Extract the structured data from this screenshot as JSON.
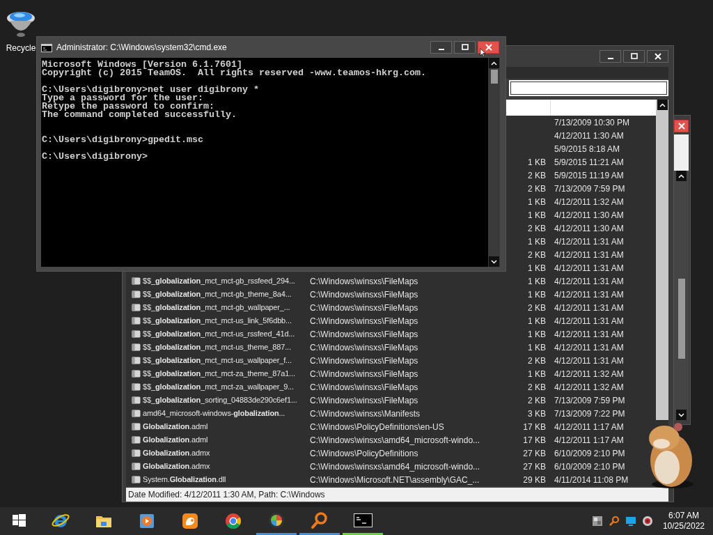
{
  "desktop": {
    "icons": [
      {
        "label": "Recycle"
      }
    ]
  },
  "cmd_window": {
    "title": "Administrator: C:\\Windows\\system32\\cmd.exe",
    "console": "Microsoft Windows [Version 6.1.7601]\nCopyright (c) 2015 TeamOS.  All rights reserved -www.teamos-hkrg.com.\n\nC:\\Users\\digibrony>net user digibrony *\nType a password for the user:\nRetype the password to confirm:\nThe command completed successfully.\n\n\nC:\\Users\\digibrony>gpedit.msc\n\nC:\\Users\\digibrony>"
  },
  "search_window": {
    "rows": [
      {
        "date": "7/13/2009 10:30 PM"
      },
      {
        "date": "4/12/2011 1:30 AM"
      },
      {
        "date": "5/9/2015 8:18 AM"
      },
      {
        "size": "1 KB",
        "date": "5/9/2015 11:21 AM"
      },
      {
        "size": "2 KB",
        "date": "5/9/2015 11:19 AM"
      },
      {
        "size": "2 KB",
        "date": "7/13/2009 7:59 PM"
      },
      {
        "size": "1 KB",
        "date": "4/12/2011 1:32 AM"
      },
      {
        "size": "1 KB",
        "date": "4/12/2011 1:30 AM"
      },
      {
        "size": "2 KB",
        "date": "4/12/2011 1:30 AM"
      },
      {
        "size": "1 KB",
        "date": "4/12/2011 1:31 AM"
      },
      {
        "size": "2 KB",
        "date": "4/12/2011 1:31 AM"
      },
      {
        "size": "1 KB",
        "date": "4/12/2011 1:31 AM"
      },
      {
        "name": "$$_**globalization**_mct_mct-gb_rssfeed_294...",
        "path": "C:\\Windows\\winsxs\\FileMaps",
        "size": "1 KB",
        "date": "4/12/2011 1:31 AM"
      },
      {
        "name": "$$_**globalization**_mct_mct-gb_theme_8a4...",
        "path": "C:\\Windows\\winsxs\\FileMaps",
        "size": "1 KB",
        "date": "4/12/2011 1:31 AM"
      },
      {
        "name": "$$_**globalization**_mct_mct-gb_wallpaper_...",
        "path": "C:\\Windows\\winsxs\\FileMaps",
        "size": "2 KB",
        "date": "4/12/2011 1:31 AM"
      },
      {
        "name": "$$_**globalization**_mct_mct-us_link_5f6dbb...",
        "path": "C:\\Windows\\winsxs\\FileMaps",
        "size": "1 KB",
        "date": "4/12/2011 1:31 AM"
      },
      {
        "name": "$$_**globalization**_mct_mct-us_rssfeed_41d...",
        "path": "C:\\Windows\\winsxs\\FileMaps",
        "size": "1 KB",
        "date": "4/12/2011 1:31 AM"
      },
      {
        "name": "$$_**globalization**_mct_mct-us_theme_887...",
        "path": "C:\\Windows\\winsxs\\FileMaps",
        "size": "1 KB",
        "date": "4/12/2011 1:31 AM"
      },
      {
        "name": "$$_**globalization**_mct_mct-us_wallpaper_f...",
        "path": "C:\\Windows\\winsxs\\FileMaps",
        "size": "2 KB",
        "date": "4/12/2011 1:31 AM"
      },
      {
        "name": "$$_**globalization**_mct_mct-za_theme_87a1...",
        "path": "C:\\Windows\\winsxs\\FileMaps",
        "size": "1 KB",
        "date": "4/12/2011 1:32 AM"
      },
      {
        "name": "$$_**globalization**_mct_mct-za_wallpaper_9...",
        "path": "C:\\Windows\\winsxs\\FileMaps",
        "size": "2 KB",
        "date": "4/12/2011 1:32 AM"
      },
      {
        "name": "$$_**globalization**_sorting_04883de290c6ef1...",
        "path": "C:\\Windows\\winsxs\\FileMaps",
        "size": "2 KB",
        "date": "7/13/2009 7:59 PM"
      },
      {
        "name": "amd64_microsoft-windows-**globalization**...",
        "path": "C:\\Windows\\winsxs\\Manifests",
        "size": "3 KB",
        "date": "7/13/2009 7:22 PM"
      },
      {
        "name": "**Globalization**.adml",
        "path": "C:\\Windows\\PolicyDefinitions\\en-US",
        "size": "17 KB",
        "date": "4/12/2011 1:17 AM"
      },
      {
        "name": "**Globalization**.adml",
        "path": "C:\\Windows\\winsxs\\amd64_microsoft-windo...",
        "size": "17 KB",
        "date": "4/12/2011 1:17 AM"
      },
      {
        "name": "**Globalization**.admx",
        "path": "C:\\Windows\\PolicyDefinitions",
        "size": "27 KB",
        "date": "6/10/2009 2:10 PM"
      },
      {
        "name": "**Globalization**.admx",
        "path": "C:\\Windows\\winsxs\\amd64_microsoft-windo...",
        "size": "27 KB",
        "date": "6/10/2009 2:10 PM"
      },
      {
        "name": "System.**Globalization**.dll",
        "path": "C:\\Windows\\Microsoft.NET\\assembly\\GAC_...",
        "size": "29 KB",
        "date": "4/11/2014 11:08 PM"
      }
    ],
    "status_bar": "Date Modified: 4/12/2011 1:30 AM, Path: C:\\Windows"
  },
  "taskbar": {
    "apps": [
      {
        "kind": "start",
        "running": false
      },
      {
        "kind": "ie",
        "running": false
      },
      {
        "kind": "folder",
        "running": false
      },
      {
        "kind": "media",
        "running": false
      },
      {
        "kind": "uc",
        "running": false
      },
      {
        "kind": "chrome",
        "running": false
      },
      {
        "kind": "orb",
        "running": true,
        "color": "#3d8fe0"
      },
      {
        "kind": "magnifier",
        "running": true,
        "color": "#3d8fe0"
      },
      {
        "kind": "terminal",
        "running": true,
        "color": "#6ccf3c"
      }
    ],
    "clock": {
      "time": "6:07 AM",
      "date": "10/25/2022"
    }
  }
}
